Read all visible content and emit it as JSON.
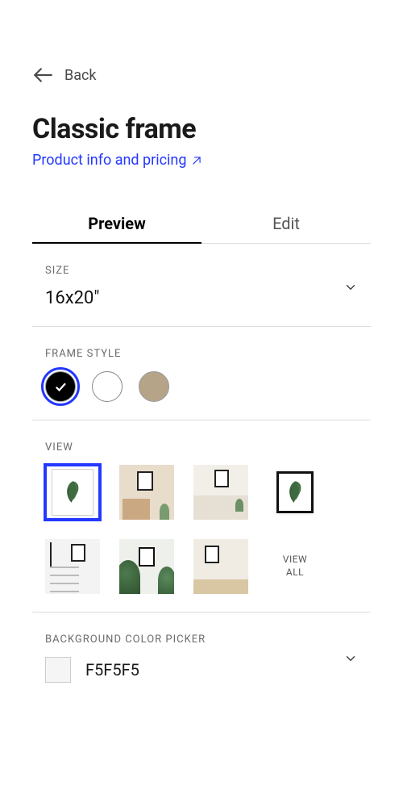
{
  "back_label": "Back",
  "title": "Classic frame",
  "info_link": "Product info and pricing",
  "tabs": {
    "preview": "Preview",
    "edit": "Edit",
    "active": "preview"
  },
  "size": {
    "label": "Size",
    "value": "16x20\""
  },
  "frame_style": {
    "label": "Frame style",
    "options": [
      {
        "name": "black",
        "color": "#000000",
        "selected": true
      },
      {
        "name": "white",
        "color": "#ffffff",
        "selected": false
      },
      {
        "name": "natural",
        "color": "#b6a489",
        "selected": false
      }
    ]
  },
  "view": {
    "label": "View",
    "view_all": "VIEW ALL",
    "thumbs": [
      {
        "kind": "product-white",
        "selected": true
      },
      {
        "kind": "room-warm",
        "selected": false
      },
      {
        "kind": "room-bed",
        "selected": false
      },
      {
        "kind": "product-black",
        "selected": false
      },
      {
        "kind": "room-shelf",
        "selected": false
      },
      {
        "kind": "room-plants",
        "selected": false
      },
      {
        "kind": "room-desk",
        "selected": false
      }
    ]
  },
  "bg": {
    "label": "Background color picker",
    "value": "F5F5F5",
    "swatch": "#f5f5f5"
  }
}
